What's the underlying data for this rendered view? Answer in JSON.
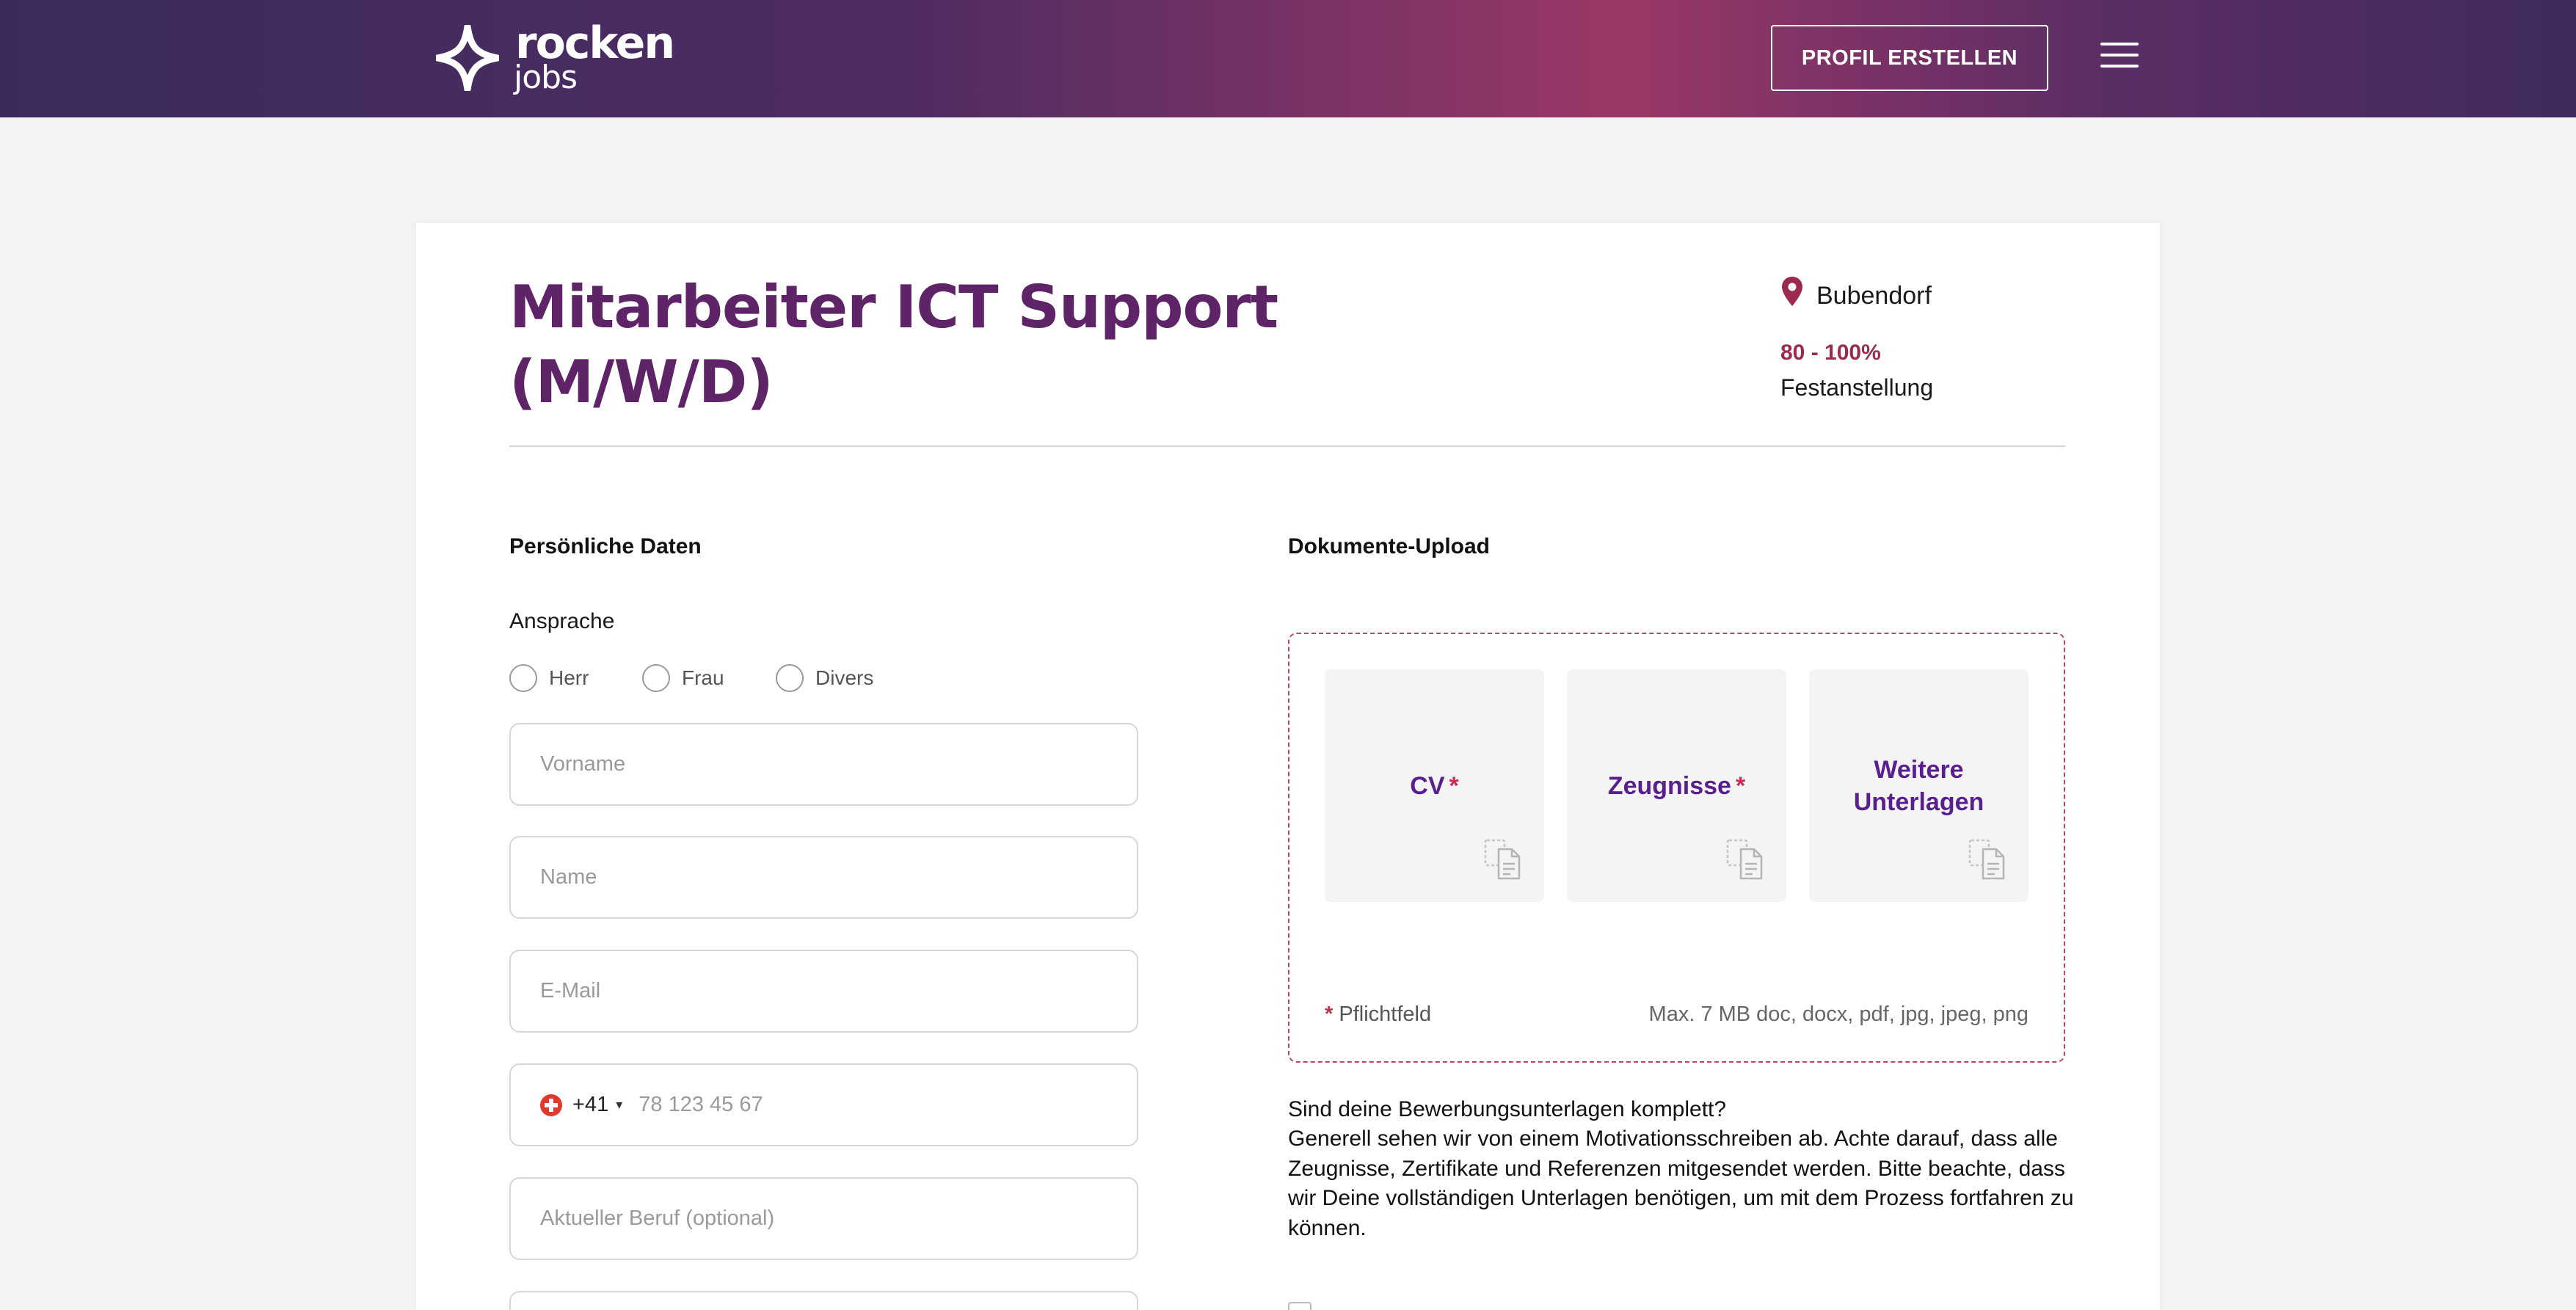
{
  "header": {
    "logo_word": "rocken",
    "logo_sub": "jobs",
    "profile_button": "PROFIL ERSTELLEN",
    "menu_icon": "hamburger-menu-icon"
  },
  "job": {
    "title": "Mitarbeiter ICT Support (M/W/D)",
    "location": "Bubendorf",
    "location_icon": "map-pin-icon",
    "workload": "80 - 100%",
    "employment_type": "Festanstellung"
  },
  "personal": {
    "section_title": "Persönliche Daten",
    "salutation_label": "Ansprache",
    "salutation_options": [
      "Herr",
      "Frau",
      "Divers"
    ],
    "fields": {
      "first_name_placeholder": "Vorname",
      "last_name_placeholder": "Name",
      "email_placeholder": "E-Mail",
      "job_placeholder": "Aktueller Beruf (optional)"
    },
    "phone": {
      "country_flag": "swiss-flag-icon",
      "dial_code": "+41",
      "caret": "▾",
      "placeholder": "78 123 45 67"
    }
  },
  "documents": {
    "section_title": "Dokumente-Upload",
    "tiles": [
      {
        "label": "CV",
        "required": "*"
      },
      {
        "label": "Zeugnisse",
        "required": "*"
      },
      {
        "label": "Weitere Unterlagen",
        "required": ""
      }
    ],
    "tile_icon": "document-upload-icon",
    "required_star": "*",
    "required_note": "Pflichtfeld",
    "file_limits": "Max. 7 MB doc, docx, pdf, jpg, jpeg, png"
  },
  "info": {
    "question": "Sind deine Bewerbungsunterlagen komplett?",
    "text": "Generell sehen wir von einem Motivationsschreiben ab. Achte darauf, dass alle Zeugnisse, Zertifikate und Referenzen mitgesendet werden. Bitte beachte, dass wir Deine vollständigen Unterlagen benötigen, um mit dem Prozess fortfahren zu können."
  },
  "colors": {
    "brand_purple": "#5e2467",
    "accent_red": "#9b2a4f",
    "tile_text": "#5a1f8e"
  }
}
